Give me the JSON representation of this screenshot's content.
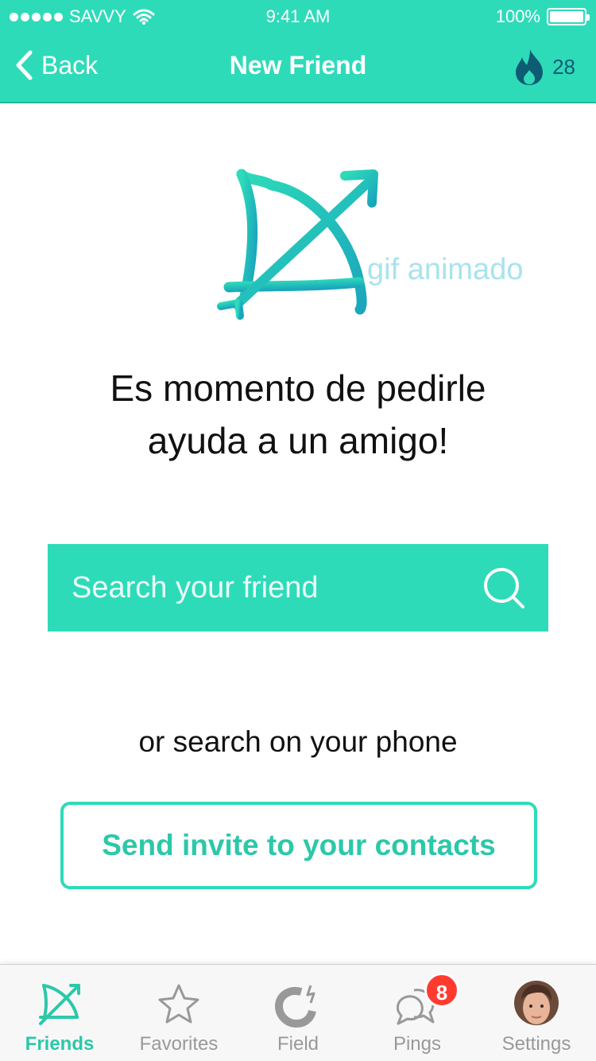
{
  "status_bar": {
    "carrier": "SAVVY",
    "time": "9:41 AM",
    "battery": "100%",
    "battery_level": 1.0
  },
  "nav": {
    "back_label": "Back",
    "title": "New Friend",
    "streak_count": "28",
    "streak_icon": "flame-icon"
  },
  "logo": {
    "caption": "gif animado",
    "icon": "bow-and-arrow-icon"
  },
  "headline": {
    "line1": "Es momento de pedirle",
    "line2": "ayuda a un amigo!"
  },
  "search": {
    "placeholder": "Search your friend",
    "value": ""
  },
  "alt_text": "or search on your phone",
  "invite_button": "Send invite to your contacts",
  "tabs": [
    {
      "label": "Friends",
      "icon": "bow-and-arrow-icon",
      "active": true
    },
    {
      "label": "Favorites",
      "icon": "star-icon",
      "active": false
    },
    {
      "label": "Field",
      "icon": "magnet-icon",
      "active": false
    },
    {
      "label": "Pings",
      "icon": "chat-bubbles-icon",
      "active": false,
      "badge": "8"
    },
    {
      "label": "Settings",
      "icon": "avatar",
      "active": false
    }
  ],
  "colors": {
    "accent": "#2EDBB9",
    "accent_text": "#2bc8a9",
    "badge": "#ff3b30",
    "streak": "#0d5c73"
  }
}
